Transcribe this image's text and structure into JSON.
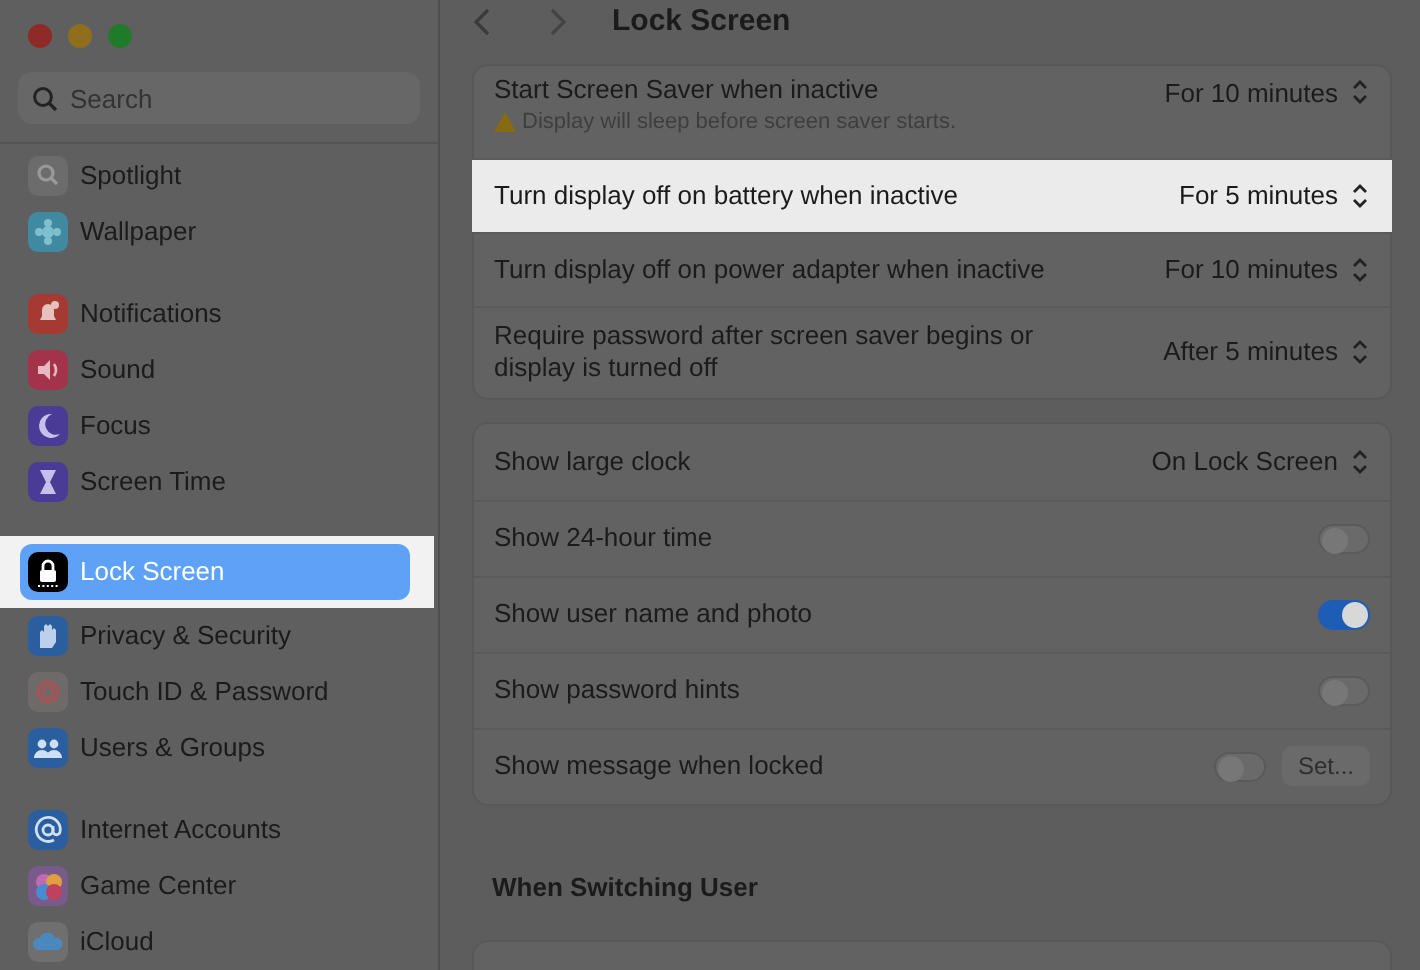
{
  "window": {
    "title": "Lock Screen"
  },
  "sidebar": {
    "search": {
      "placeholder": "Search"
    },
    "groups": [
      [
        {
          "label": "Spotlight",
          "color": "#6c6c6c",
          "selected": false
        },
        {
          "label": "Wallpaper",
          "color": "#3f8aa0",
          "selected": false
        }
      ],
      [
        {
          "label": "Notifications",
          "color": "#a53a33",
          "selected": false
        },
        {
          "label": "Sound",
          "color": "#a3334a",
          "selected": false
        },
        {
          "label": "Focus",
          "color": "#4a3c96",
          "selected": false
        },
        {
          "label": "Screen Time",
          "color": "#4a3c96",
          "selected": false
        }
      ],
      [
        {
          "label": "Lock Screen",
          "color": "#000000",
          "selected": true
        },
        {
          "label": "Privacy & Security",
          "color": "#2b5e9e",
          "selected": false
        },
        {
          "label": "Touch ID & Password",
          "color": "#6e6a6a",
          "selected": false
        },
        {
          "label": "Users & Groups",
          "color": "#2b5e9e",
          "selected": false
        }
      ],
      [
        {
          "label": "Internet Accounts",
          "color": "#2b5e9e",
          "selected": false
        },
        {
          "label": "Game Center",
          "color": "#7a5a8a",
          "selected": false
        },
        {
          "label": "iCloud",
          "color": "#6f6f6f",
          "selected": false
        }
      ]
    ]
  },
  "cards": [
    [
      {
        "kind": "popup",
        "label": "Start Screen Saver when inactive",
        "note": "Display will sleep before screen saver starts.",
        "value": "For 10 minutes",
        "highlighted": false
      },
      {
        "kind": "popup",
        "label": "Turn display off on battery when inactive",
        "value": "For 5 minutes",
        "highlighted": true
      },
      {
        "kind": "popup",
        "label": "Turn display off on power adapter when inactive",
        "value": "For 10 minutes",
        "highlighted": false
      },
      {
        "kind": "popup",
        "label": "Require password after screen saver begins or display is turned off",
        "value": "After 5 minutes",
        "highlighted": false
      }
    ],
    [
      {
        "kind": "popup",
        "label": "Show large clock",
        "value": "On Lock Screen",
        "highlighted": false
      },
      {
        "kind": "toggle",
        "label": "Show 24-hour time",
        "on": false,
        "highlighted": false
      },
      {
        "kind": "toggle",
        "label": "Show user name and photo",
        "on": true,
        "highlighted": false
      },
      {
        "kind": "toggle",
        "label": "Show password hints",
        "on": false,
        "highlighted": false
      },
      {
        "kind": "toggle",
        "label": "Show message when locked",
        "on": false,
        "button": "Set...",
        "highlighted": false
      }
    ]
  ],
  "section_heading": "When Switching User"
}
